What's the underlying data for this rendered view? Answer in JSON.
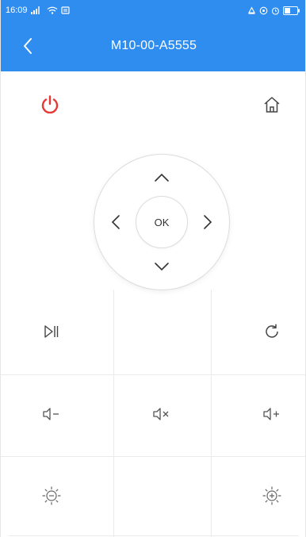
{
  "status_bar": {
    "time": "16:09",
    "icons_left": [
      "signal-icon",
      "wifi-icon",
      "sim-icon"
    ],
    "icons_right": [
      "alarm-icon",
      "location-icon",
      "clock-icon",
      "battery-icon"
    ]
  },
  "header": {
    "title": "M10-00-A5555",
    "back_icon": "chevron-left-icon",
    "accent_color": "#2f8df0"
  },
  "controls": {
    "power": {
      "icon": "power-icon",
      "color": "#e53935"
    },
    "home": {
      "icon": "home-icon"
    },
    "dpad": {
      "ok_label": "OK",
      "up_icon": "chevron-up-icon",
      "down_icon": "chevron-down-icon",
      "left_icon": "chevron-left-icon",
      "right_icon": "chevron-right-icon"
    },
    "play_pause": {
      "icon": "play-pause-icon"
    },
    "refresh": {
      "icon": "refresh-icon"
    },
    "volume_down": {
      "icon": "volume-down-icon"
    },
    "mute": {
      "icon": "mute-icon"
    },
    "volume_up": {
      "icon": "volume-up-icon"
    },
    "brightness_down": {
      "icon": "brightness-down-icon"
    },
    "brightness_up": {
      "icon": "brightness-up-icon"
    }
  }
}
